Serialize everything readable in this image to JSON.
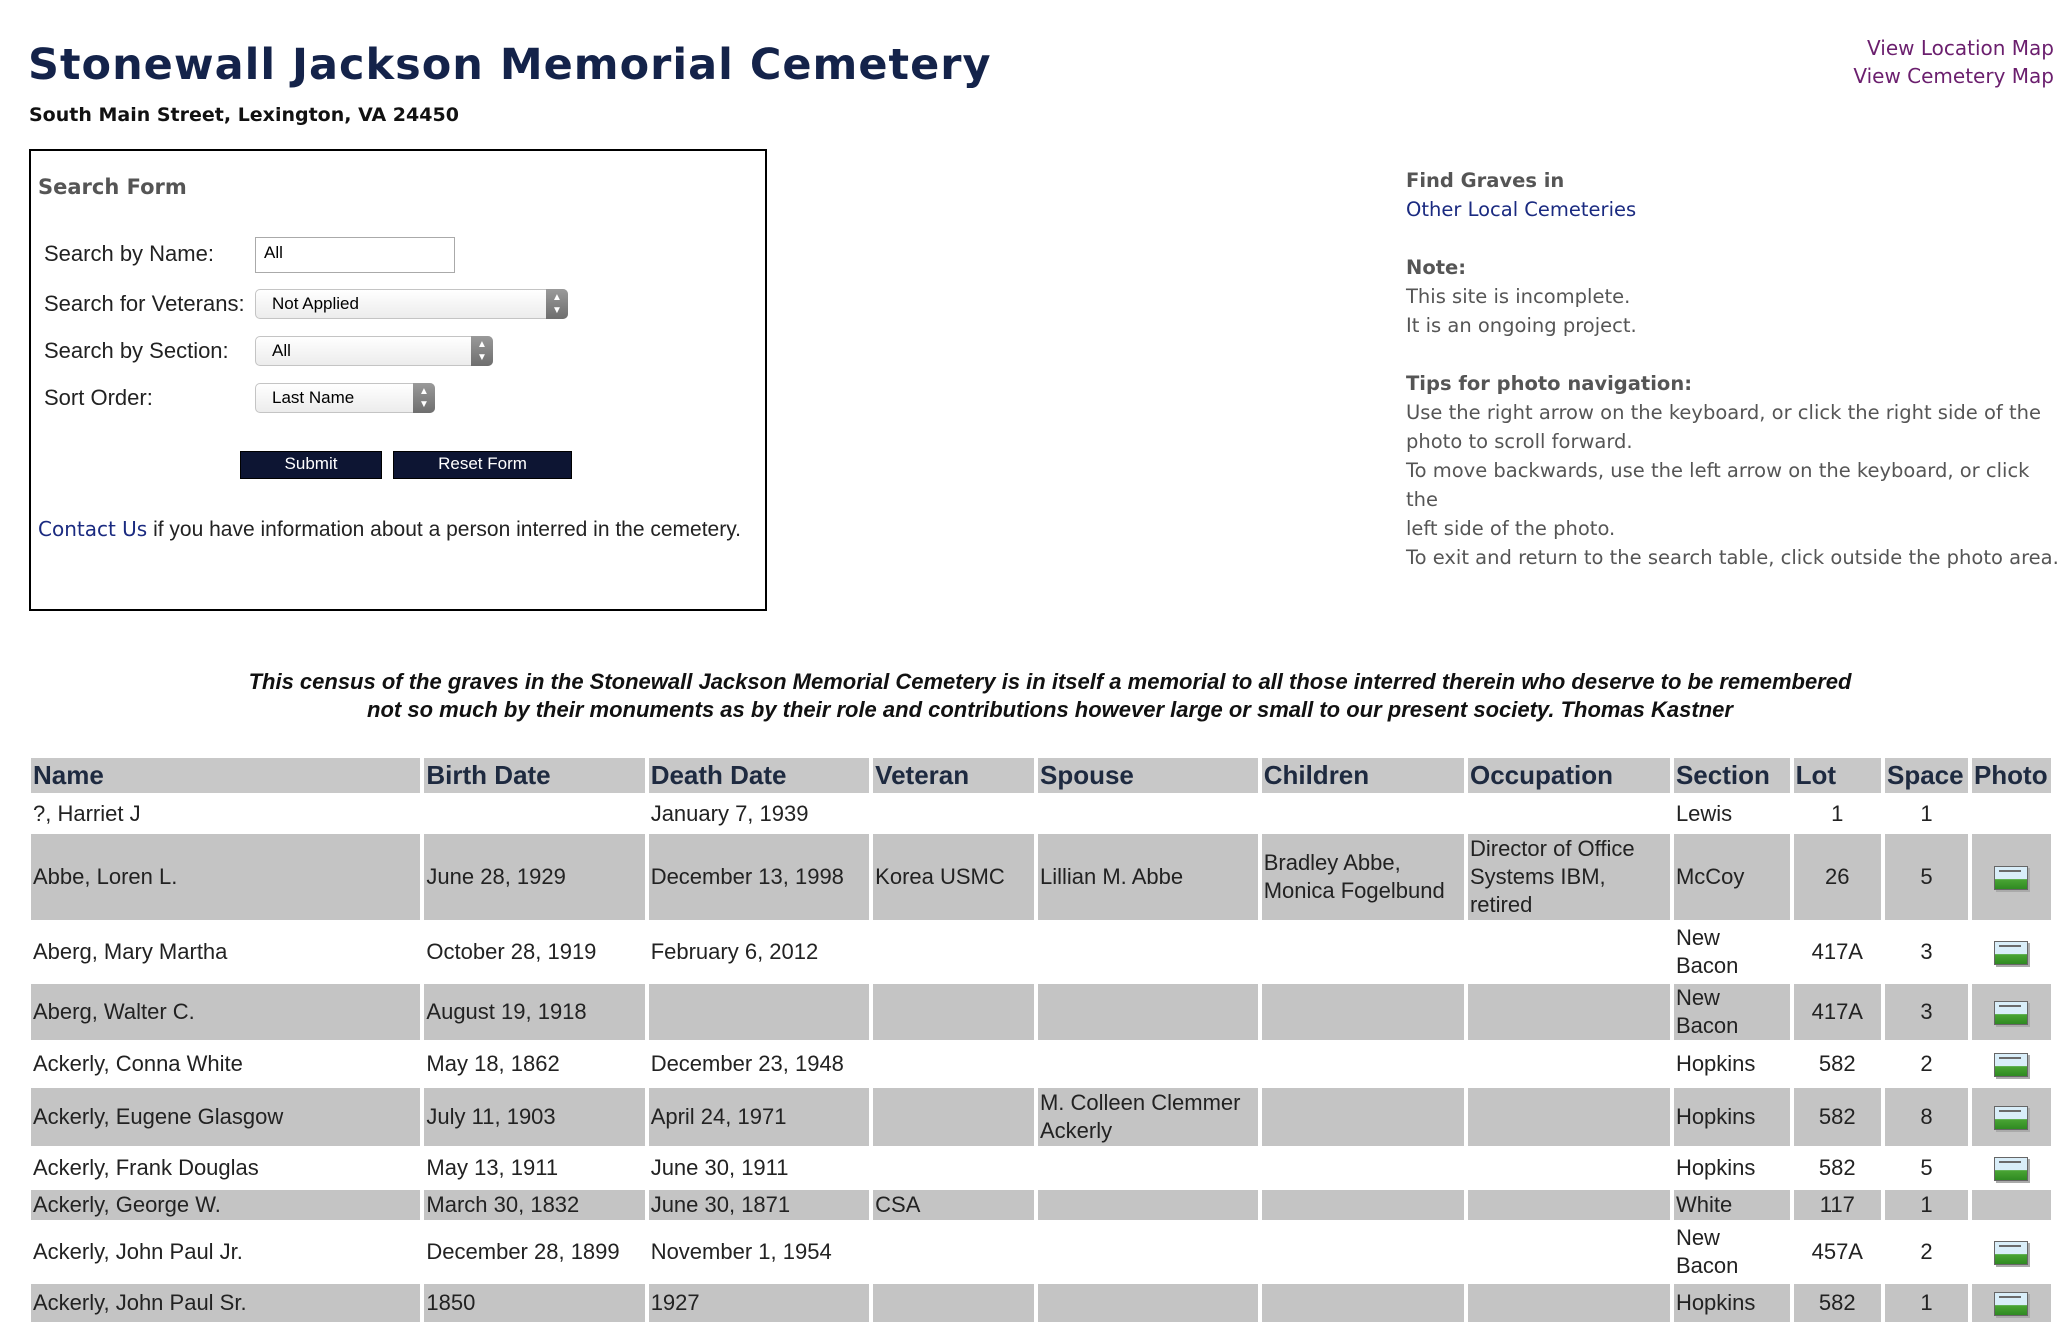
{
  "header": {
    "title": "Stonewall Jackson Memorial Cemetery",
    "address": "South Main Street,  Lexington, VA 24450",
    "location_map_link": "View Location Map",
    "cemetery_map_link": "View Cemetery Map"
  },
  "search_form": {
    "title": "Search Form",
    "name_label": "Search by Name:",
    "name_value": "All",
    "veterans_label": "Search for Veterans:",
    "veterans_value": "Not Applied",
    "section_label": "Search by Section:",
    "section_value": "All",
    "sort_label": "Sort Order:",
    "sort_value": "Last Name",
    "submit_label": "Submit",
    "reset_label": "Reset Form",
    "contact_link": "Contact Us",
    "contact_text": " if you have information about a person interred in the cemetery."
  },
  "info": {
    "find_label": "Find Graves in",
    "other_link": "Other Local Cemeteries",
    "note_label": "Note:",
    "note_line1": "This site is incomplete.",
    "note_line2": "It is an ongoing project.",
    "tips_label": "Tips for photo navigation:",
    "tips_line1": "Use the right arrow on the keyboard, or click the right side of the",
    "tips_line2": "photo to scroll forward.",
    "tips_line3": "To move backwards, use the left arrow on the keyboard, or click the",
    "tips_line4": "left side of the photo.",
    "tips_line5": "To exit and return to the search table, click outside the photo area."
  },
  "quote": {
    "line1": "This census of the graves in the Stonewall Jackson Memorial Cemetery is in itself a memorial to all those interred therein who deserve to be remembered",
    "line2": "not so much by their monuments as by their role and contributions however large or small to our present society.     Thomas Kastner"
  },
  "table": {
    "headers": [
      "Name",
      "Birth Date",
      "Death Date",
      "Veteran",
      "Spouse",
      "Children",
      "Occupation",
      "Section",
      "Lot",
      "Space",
      "Photo"
    ],
    "rows": [
      {
        "name": "?, Harriet J",
        "birth": "",
        "death": "January 7, 1939",
        "veteran": "",
        "spouse": "",
        "children": "",
        "occupation": "",
        "section": "Lewis",
        "lot": "1",
        "space": "1",
        "photo": false
      },
      {
        "name": "Abbe, Loren L.",
        "birth": "June 28, 1929",
        "death": "December 13, 1998",
        "veteran": "Korea USMC",
        "spouse": "Lillian M. Abbe",
        "children": "Bradley Abbe, Monica Fogelbund",
        "occupation": "Director of Office Systems IBM, retired",
        "section": "McCoy",
        "lot": "26",
        "space": "5",
        "photo": true
      },
      {
        "name": "Aberg, Mary Martha",
        "birth": "October 28, 1919",
        "death": "February 6, 2012",
        "veteran": "",
        "spouse": "",
        "children": "",
        "occupation": "",
        "section": "New Bacon",
        "lot": "417A",
        "space": "3",
        "photo": true
      },
      {
        "name": "Aberg, Walter C.",
        "birth": "August 19, 1918",
        "death": "",
        "veteran": "",
        "spouse": "",
        "children": "",
        "occupation": "",
        "section": "New Bacon",
        "lot": "417A",
        "space": "3",
        "photo": true
      },
      {
        "name": "Ackerly, Conna White",
        "birth": "May 18, 1862",
        "death": "December 23, 1948",
        "veteran": "",
        "spouse": "",
        "children": "",
        "occupation": "",
        "section": "Hopkins",
        "lot": "582",
        "space": "2",
        "photo": true
      },
      {
        "name": "Ackerly, Eugene Glasgow",
        "birth": "July 11, 1903",
        "death": "April 24, 1971",
        "veteran": "",
        "spouse": "M. Colleen Clemmer Ackerly",
        "children": "",
        "occupation": "",
        "section": "Hopkins",
        "lot": "582",
        "space": "8",
        "photo": true
      },
      {
        "name": "Ackerly, Frank Douglas",
        "birth": "May 13, 1911",
        "death": "June 30, 1911",
        "veteran": "",
        "spouse": "",
        "children": "",
        "occupation": "",
        "section": "Hopkins",
        "lot": "582",
        "space": "5",
        "photo": true
      },
      {
        "name": "Ackerly, George W.",
        "birth": "March 30, 1832",
        "death": "June 30, 1871",
        "veteran": "CSA",
        "spouse": "",
        "children": "",
        "occupation": "",
        "section": "White",
        "lot": "117",
        "space": "1",
        "photo": false
      },
      {
        "name": "Ackerly, John Paul Jr.",
        "birth": "December 28, 1899",
        "death": "November 1, 1954",
        "veteran": "",
        "spouse": "",
        "children": "",
        "occupation": "",
        "section": "New Bacon",
        "lot": "457A",
        "space": "2",
        "photo": true
      },
      {
        "name": "Ackerly, John Paul Sr.",
        "birth": "1850",
        "death": "1927",
        "veteran": "",
        "spouse": "",
        "children": "",
        "occupation": "",
        "section": "Hopkins",
        "lot": "582",
        "space": "1",
        "photo": true
      }
    ]
  }
}
